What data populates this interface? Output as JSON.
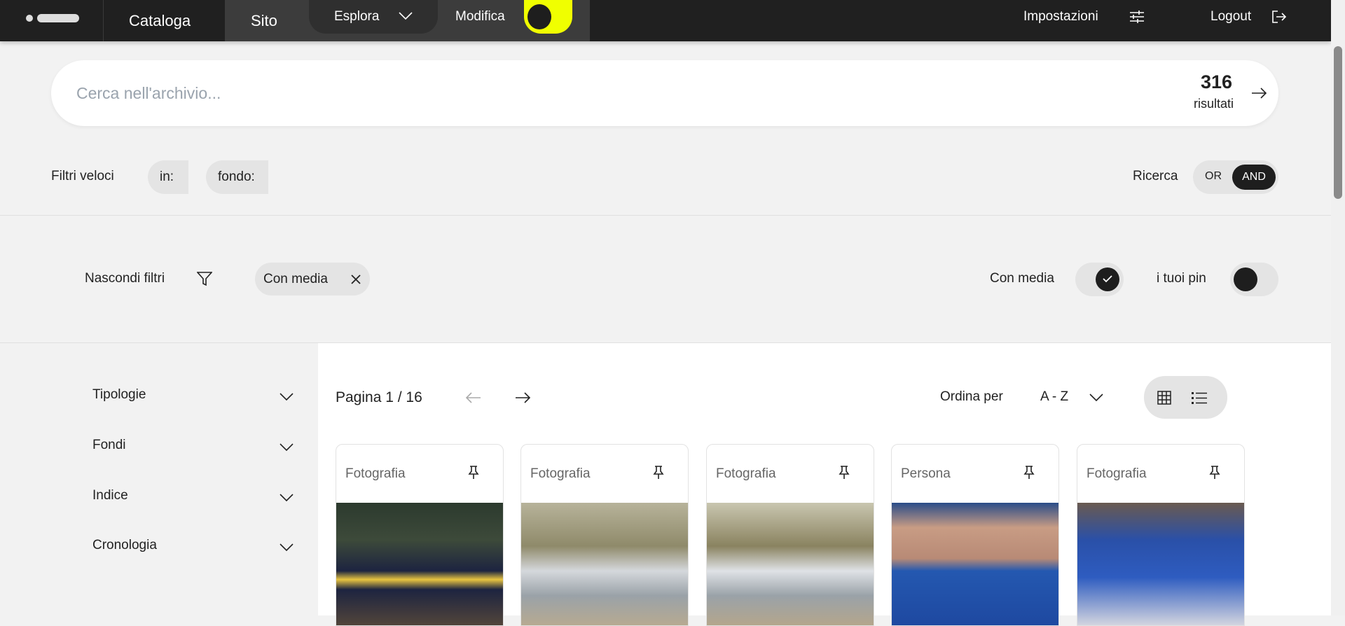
{
  "nav": {
    "catalog": "Cataloga",
    "site": "Sito",
    "explore": "Esplora",
    "edit": "Modifica",
    "settings": "Impostazioni",
    "logout": "Logout",
    "accent": "#f0ff00"
  },
  "search": {
    "placeholder": "Cerca nell'archivio...",
    "count": "316",
    "count_label": "risultati"
  },
  "quick_filters": {
    "label": "Filtri veloci",
    "chips": [
      "in:",
      "fondo:"
    ],
    "search_mode_label": "Ricerca",
    "modes": [
      "OR",
      "AND"
    ],
    "active_mode": "AND"
  },
  "filters": {
    "hide_label": "Nascondi filtri",
    "active_chip": "Con media",
    "toggles": [
      {
        "label": "Con media",
        "on": true
      },
      {
        "label": "i tuoi pin",
        "on": false
      }
    ]
  },
  "sidebar": {
    "items": [
      "Tipologie",
      "Fondi",
      "Indice",
      "Cronologia"
    ]
  },
  "results": {
    "page_label": "Pagina 1 / 16",
    "sort_label": "Ordina per",
    "sort_value": "A - Z"
  },
  "cards": [
    {
      "type": "Fotografia"
    },
    {
      "type": "Fotografia"
    },
    {
      "type": "Fotografia"
    },
    {
      "type": "Persona"
    },
    {
      "type": "Fotografia"
    }
  ]
}
